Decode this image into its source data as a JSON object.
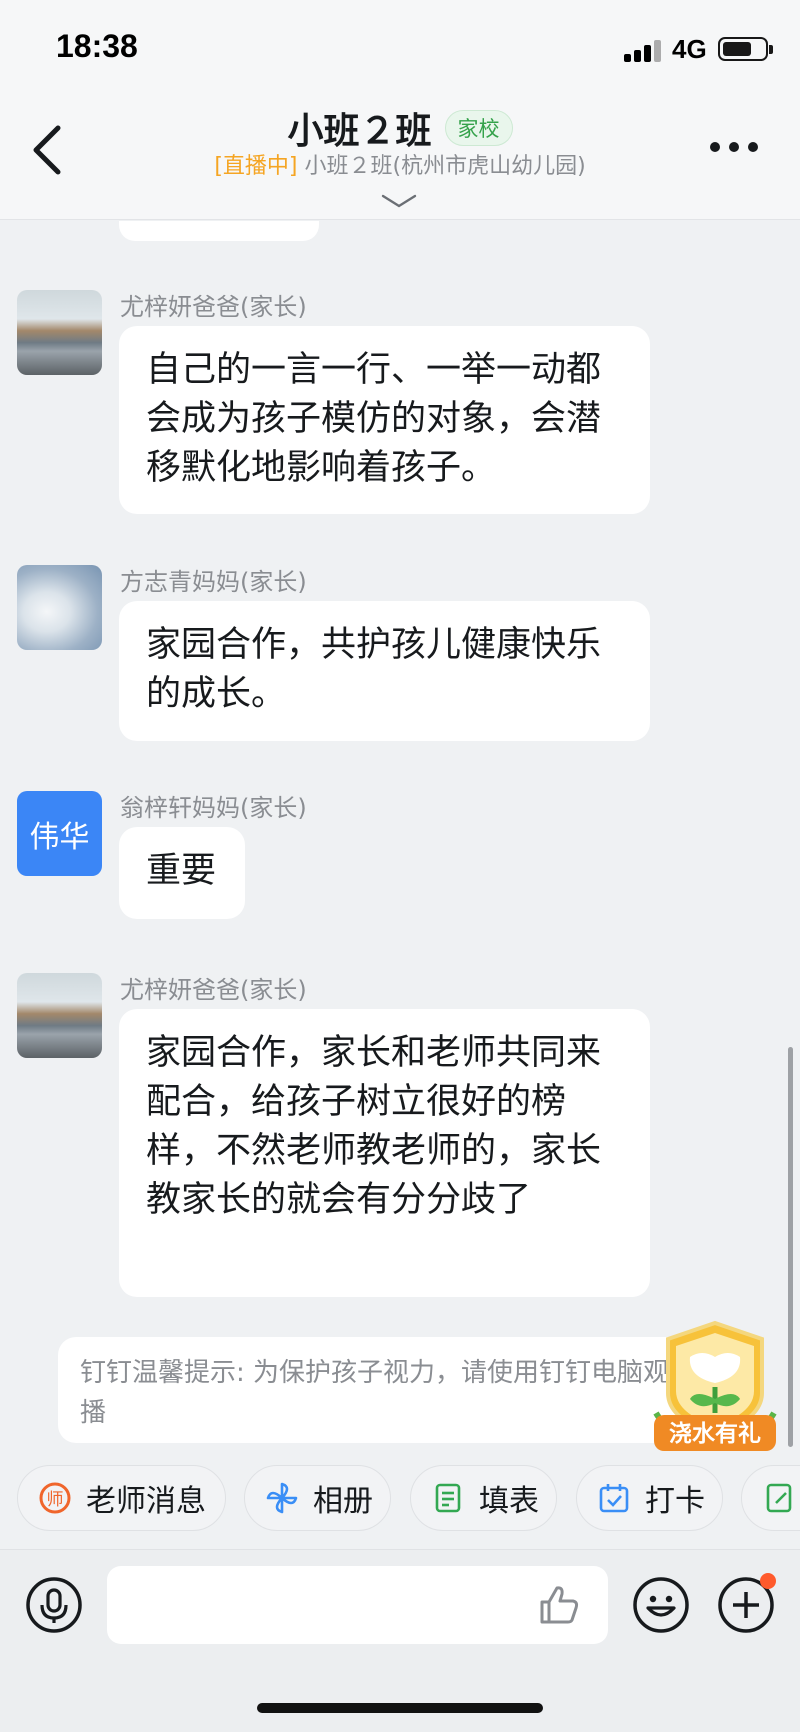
{
  "status_bar": {
    "time": "18:38",
    "network": "4G"
  },
  "header": {
    "title": "小班２班",
    "tag": "家校",
    "live_label": "[直播中]",
    "class_label": "小班２班(杭州市虎山幼儿园)"
  },
  "messages": [
    {
      "sender": "尤梓妍爸爸(家长)",
      "avatar": "street-photo-avatar",
      "text": "自己的一言一行、一举一动都会成为孩子模仿的对象，会潜移默化地影响着孩子。"
    },
    {
      "sender": "方志青妈妈(家长)",
      "avatar": "sky-photo-avatar",
      "text": "家园合作，共护孩儿健康快乐的成长。"
    },
    {
      "sender": "翁梓轩妈妈(家长)",
      "avatar_text": "伟华",
      "text": "重要"
    },
    {
      "sender": "尤梓妍爸爸(家长)",
      "avatar": "street-photo-avatar",
      "text": "家园合作，家长和老师共同来配合，给孩子树立很好的榜样，不然老师教老师的，家长教家长的就会有分分歧了"
    }
  ],
  "tip": {
    "text": "钉钉温馨提示: 为保护孩子视力，请使用钉钉电脑观看直播"
  },
  "badge": {
    "text": "浇水有礼"
  },
  "quick_actions": [
    {
      "label": "老师消息",
      "icon": "teacher-badge-icon",
      "color": "#f0652b"
    },
    {
      "label": "相册",
      "icon": "pinwheel-icon",
      "color": "#3a8ef6"
    },
    {
      "label": "填表",
      "icon": "form-icon",
      "color": "#33a852"
    },
    {
      "label": "打卡",
      "icon": "calendar-check-icon",
      "color": "#3a8ef6"
    },
    {
      "label": "",
      "icon": "notebook-icon",
      "color": "#33a852"
    }
  ],
  "input": {
    "placeholder": ""
  }
}
